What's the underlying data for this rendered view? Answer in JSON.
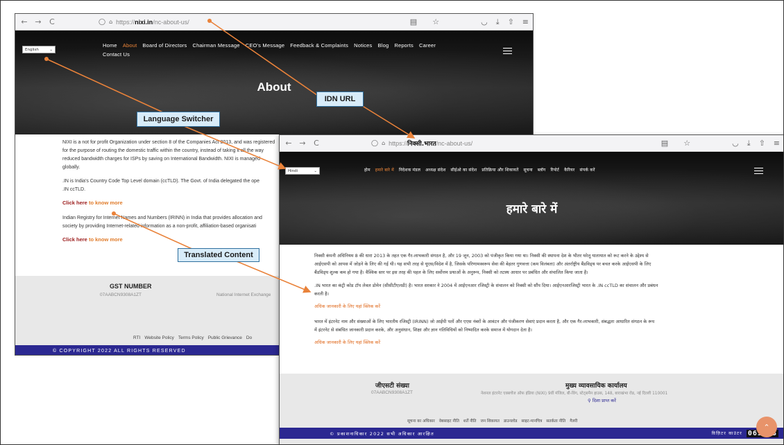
{
  "callouts": {
    "language_switcher": "Language Switcher",
    "idn_url": "IDN URL",
    "translated_content": "Translated Content"
  },
  "english_window": {
    "url_prefix": "https://",
    "url_domain": "nixi.in",
    "url_path": "/nc-about-us/",
    "language": "English",
    "nav": [
      "Home",
      "About",
      "Board of Directors",
      "Chairman Message",
      "CEO's Message",
      "Feedback & Complaints",
      "Notices",
      "Blog",
      "Reports",
      "Career",
      "Contact Us"
    ],
    "active_nav": "About",
    "hero_title": "About",
    "paragraphs": [
      "NIXI is a not for profit Organization under section 8 of the Companies Act 2013, and was registered",
      "for the purpose of routing the domestic traffic within the country, instead of taking it all the way",
      "reduced bandwidth charges for ISPs by saving on International Bandwidth. NIXI is managed",
      "globally."
    ],
    "paragraph2_line1": ".IN is India's Country Code Top Level domain (ccTLD). The Govt. of India delegated the ope",
    "paragraph2_line2": ".IN ccTLD.",
    "know_more_1_prefix": "Click here",
    "know_more_1_suffix": " to know more",
    "paragraph3_line1": "Indian Registry for Internet Names and Numbers (IRINN) in India that provides allocation and",
    "paragraph3_line2": "society by providing Internet-related information as a non-profit, affiliation-based organisati",
    "know_more_2_prefix": "Click here",
    "know_more_2_suffix": " to know more",
    "gst_title": "GST NUMBER",
    "gst_value": "07AABCN9308A1ZT",
    "exchange_text": "National Internet Exchange",
    "footer_links": [
      "RTI",
      "Website Policy",
      "Terms Policy",
      "Public Grievance",
      "Do"
    ],
    "copyright": "© COPYRIGHT 2022 ALL RIGHTS RESERVED"
  },
  "hindi_window": {
    "url_prefix": "https://",
    "url_domain": "निक्सी.भारत",
    "url_path": "/nc-about-us/",
    "language": "Hindi",
    "nav": [
      "होम",
      "हमारे बारे में",
      "निदेशक मंडल",
      "अध्यक्ष संदेश",
      "सीईओ का संदेश",
      "प्रतिक्रिया और शिकायतें",
      "सूचना",
      "ब्लॉग",
      "रिपोर्ट",
      "कैरियर",
      "संपर्क करें"
    ],
    "active_nav": "हमारे बारे में",
    "hero_title": "हमारे बारे में",
    "para1_line1": "निक्सी कंपनी अधिनियम 8 की धारा 2013 के तहत एक गैर-लाभकारी संगठन है, और 19 जून, 2003 को पंजीकृत किया गया था। निक्सी की स्थापना देश के भीतर घरेलू यातायात को रूट करने के उद्देश्य से",
    "para1_line2": "आईएसपी को आपस में जोड़ने के लिए की गई थी। यह सभी तरह से यूएस/विदेश में है, जिसके परिणामस्वरूप सेवा की बेहतर गुणवत्ता (कम विलंबता) और अंतर्राष्ट्रीय बैंडविड्थ पर बचत करके आईएसपी के लिए",
    "para1_line3": "बैंडविड्थ शुल्क कम हो गया है। वैश्विक स्तर पर इस तरह की पहल के लिए सर्वोत्तम प्रथाओं के अनुरूप, निक्सी को तटस्थ आधार पर प्रबंधित और संचालित किया जाता है।",
    "para2_line1": ".IN भारत का कंट्री कोड टॉप लेवल डोमेन (सीसीटीएलडी) है। भारत सरकार ने 2004 में आईएनआर रजिस्ट्री के संचालन को निक्सी को सौंप दिया। आईएनआरजिस्ट्री भारत के .IN ccTLD का संचालन और प्रबंधन",
    "para2_line2": "करती है।",
    "know_more_1": "अधिक जानकारी के लिए यहां क्लिक करें",
    "para3_line1": "भारत में इंटरनेट नाम और संख्याओं के लिए भारतीय रजिस्ट्री (IRINN) जो आईपी पतों और एएस नंबरों के आवंटन और पंजीकरण सेवाएं प्रदान करता है, और एक गैर-लाभकारी, संबद्धता आधारित संगठन के रूप",
    "para3_line2": "में इंटरनेट से संबंधित जानकारी प्रदान करके, और अनुसंधान, शिक्षा और ज्ञान गतिविधियों को निष्पादित करके समाज में योगदान देता है।",
    "know_more_2": "अधिक जानकारी के लिए यहां क्लिक करें",
    "gst_title": "जीएसटी संख्या",
    "gst_value": "07AABCN9308A1ZT",
    "office_title": "मुख्य व्यावसायिक कार्यालय",
    "office_address": "नेशनल इंटरनेट एक्सचेंज ऑफ इंडिया (NIXI) 9वीं मंजिल, बी-विंग, स्टेट्समैन हाउस, 148, बाराखंभा रोड, नई दिल्ली 110001",
    "directions": "दिशा प्राप्त करें",
    "footer_links": [
      "सूचना का अधिकार",
      "वेबसाइट नीति",
      "शर्तें नीति",
      "जन शिकायत",
      "डाउनलोड",
      "साइट-मानचित्र",
      "सतर्कता नीति",
      "गैलरी"
    ],
    "copyright": "© प्रकाशनाधिकार 2022 सभी अधिकार आरक्षित",
    "visitor_label": "विज़िटर काउंटर",
    "visitor_count": "063413"
  },
  "icons": {
    "back": "←",
    "forward": "→",
    "reload": "C",
    "shield": "◯",
    "lock": "🔒︎",
    "reader": "▤",
    "star": "☆",
    "pocket": "◡",
    "download": "⤓",
    "extensions": "⇧",
    "menu": "≡",
    "scroll_up": "⌃"
  },
  "colors": {
    "accent_orange": "#e07b2a",
    "callout_bg": "#d8ecf9",
    "copyright_bar": "#2b2891"
  }
}
